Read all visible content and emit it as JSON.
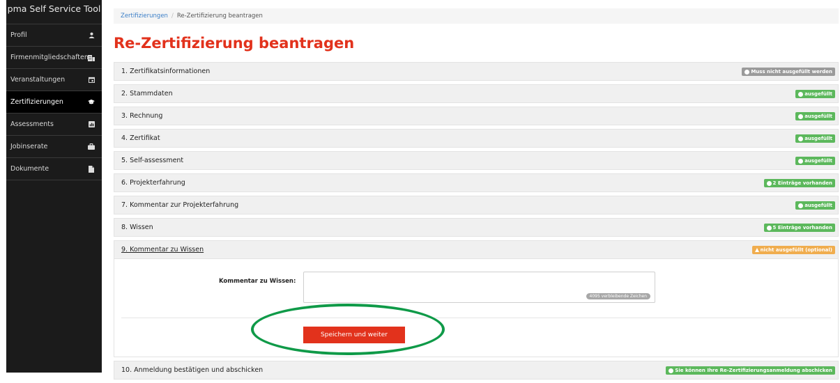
{
  "app": {
    "title": "pma Self Service Tool"
  },
  "sidebar": {
    "items": [
      {
        "label": "Profil",
        "icon": "user-icon"
      },
      {
        "label": "Firmenmitgliedschaften",
        "icon": "building-icon"
      },
      {
        "label": "Veranstaltungen",
        "icon": "calendar-icon"
      },
      {
        "label": "Zertifizierungen",
        "icon": "graduation-cap-icon",
        "active": true
      },
      {
        "label": "Assessments",
        "icon": "bar-chart-icon"
      },
      {
        "label": "Jobinserate",
        "icon": "briefcase-icon"
      },
      {
        "label": "Dokumente",
        "icon": "document-icon"
      }
    ]
  },
  "breadcrumb": {
    "link": "Zertifizierungen",
    "separator": "/",
    "current": "Re-Zertifizierung beantragen"
  },
  "page": {
    "title": "Re-Zertifizierung beantragen"
  },
  "sections": [
    {
      "label": "1. Zertifikatsinformationen",
      "badge": "Muss nicht ausgefüllt werden",
      "status": "gray"
    },
    {
      "label": "2. Stammdaten",
      "badge": "ausgefüllt",
      "status": "green"
    },
    {
      "label": "3. Rechnung",
      "badge": "ausgefüllt",
      "status": "green"
    },
    {
      "label": "4. Zertifikat",
      "badge": "ausgefüllt",
      "status": "green"
    },
    {
      "label": "5. Self-assessment",
      "badge": "ausgefüllt",
      "status": "green"
    },
    {
      "label": "6. Projekterfahrung",
      "badge": "2 Einträge vorhanden",
      "status": "green"
    },
    {
      "label": "7. Kommentar zur Projekterfahrung",
      "badge": "ausgefüllt",
      "status": "green"
    },
    {
      "label": "8. Wissen",
      "badge": "5 Einträge vorhanden",
      "status": "green"
    },
    {
      "label": "9. Kommentar zu Wissen",
      "badge": "nicht ausgefüllt (optional)",
      "status": "orange",
      "open": true
    },
    {
      "label": "10. Anmeldung bestätigen und abschicken",
      "badge": "Sie können Ihre Re-Zertifizierungsanmeldung abschicken",
      "status": "green"
    }
  ],
  "form": {
    "field_label": "Kommentar zu Wissen:",
    "counter": "4095 verbleibende Zeichen",
    "save_label": "Speichern und weiter"
  },
  "colors": {
    "accent": "#e2321c",
    "success": "#5cb85c",
    "warning": "#f0ad4e",
    "muted": "#9a9a9a",
    "highlight": "#0f9a48"
  }
}
